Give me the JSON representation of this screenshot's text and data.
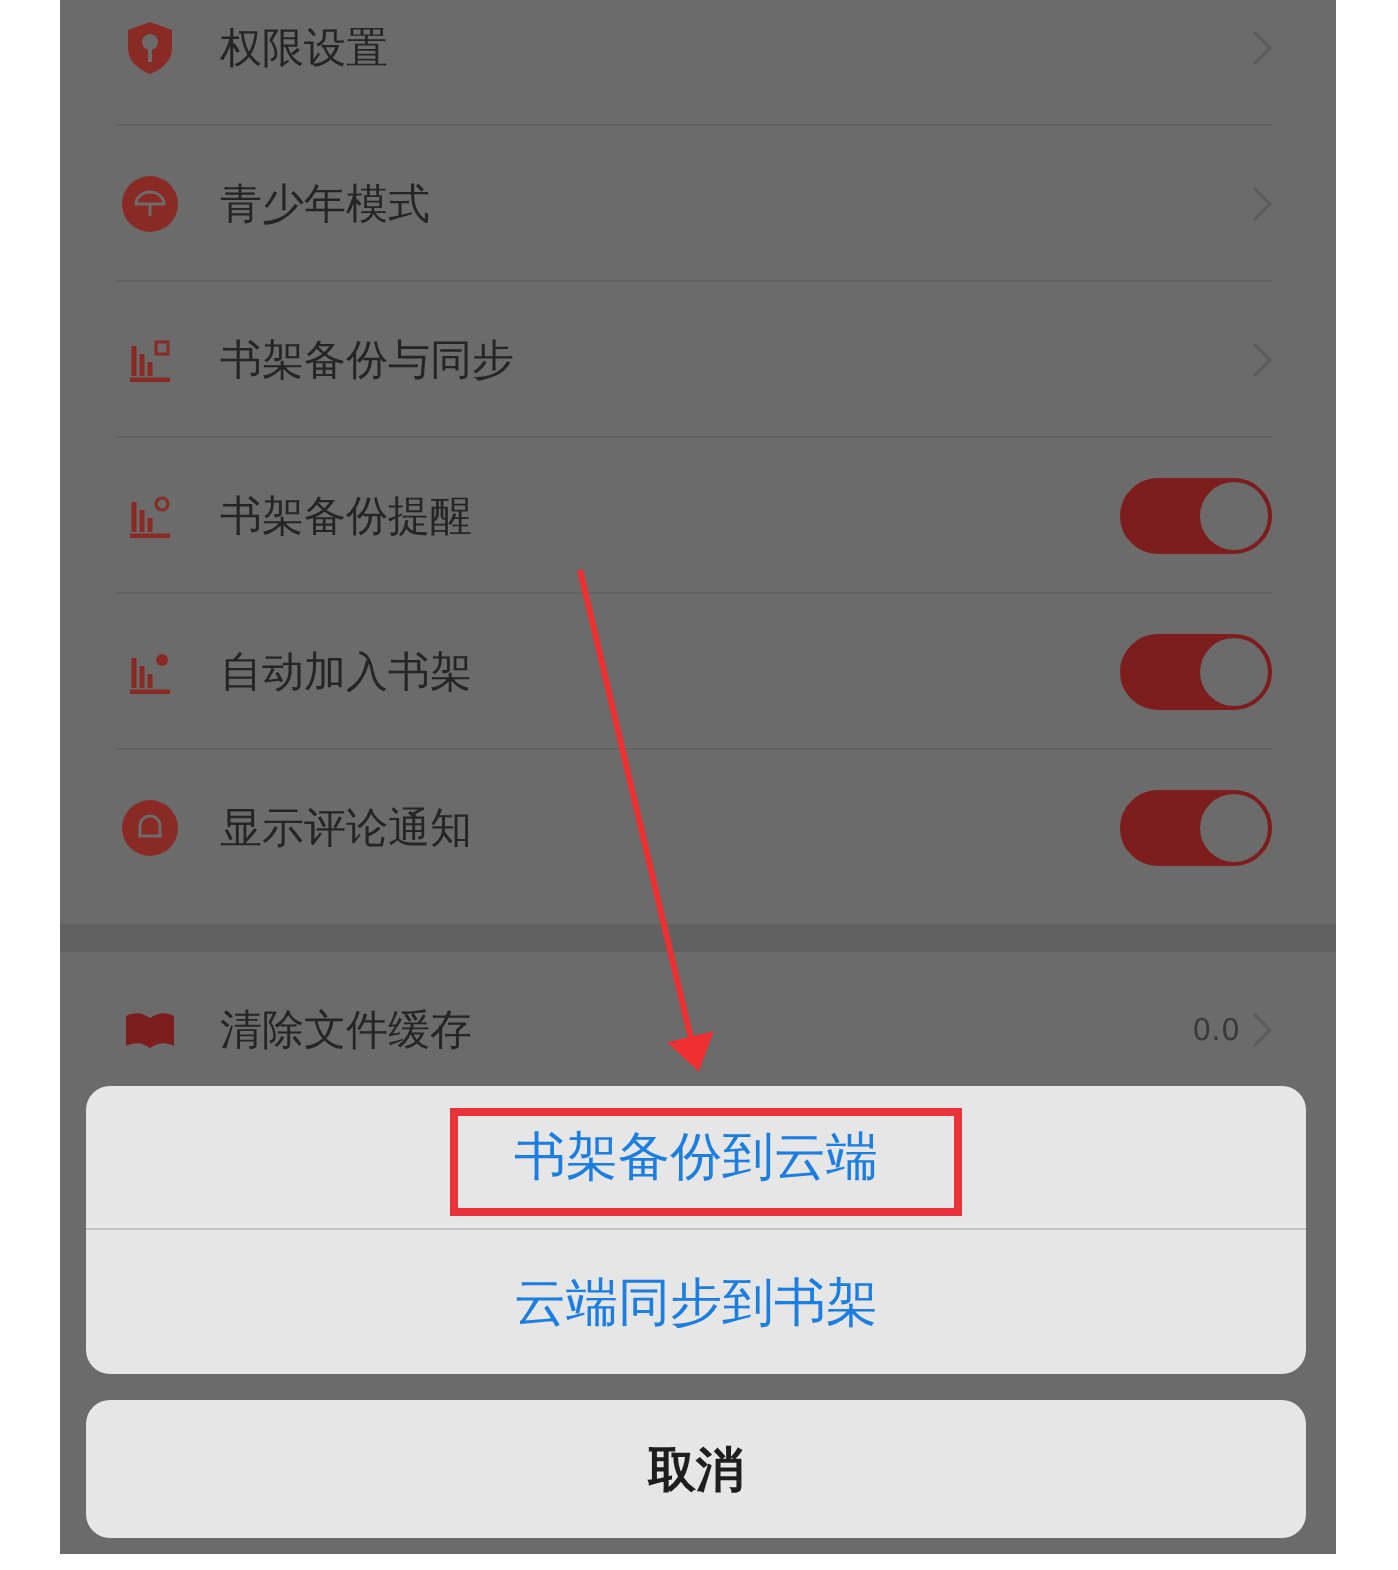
{
  "settings": [
    {
      "kind": "link",
      "label": "权限设置"
    },
    {
      "kind": "link",
      "label": "青少年模式"
    },
    {
      "kind": "link",
      "label": "书架备份与同步"
    },
    {
      "kind": "toggle",
      "label": "书架备份提醒",
      "on": true
    },
    {
      "kind": "toggle",
      "label": "自动加入书架",
      "on": true
    },
    {
      "kind": "toggle",
      "label": "显示评论通知",
      "on": true
    }
  ],
  "cache": [
    {
      "kind": "link",
      "label": "清除文件缓存",
      "value": "0.0"
    }
  ],
  "action_sheet": {
    "items": [
      "书架备份到云端",
      "云端同步到书架"
    ],
    "cancel": "取消"
  }
}
